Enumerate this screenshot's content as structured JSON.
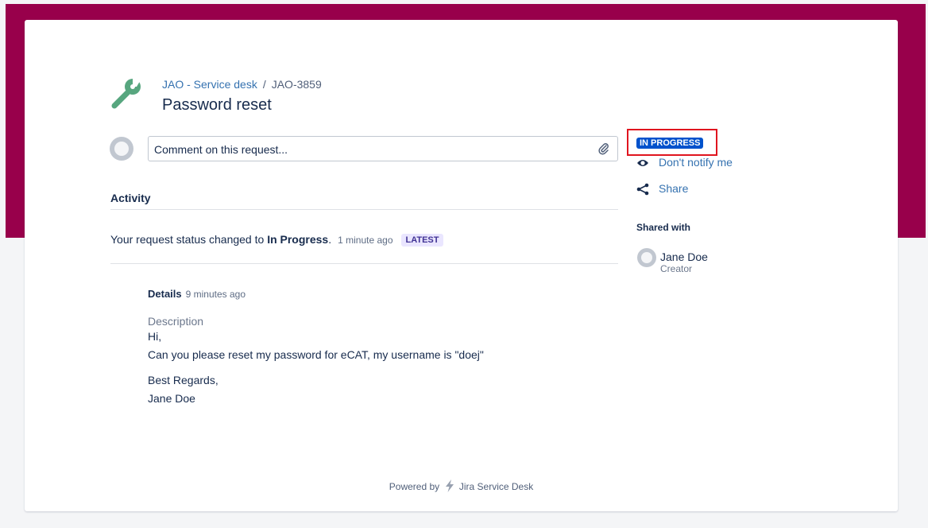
{
  "colors": {
    "brand_band": "#98004b",
    "page_bg": "#f4f5f7",
    "card_bg": "#ffffff",
    "link": "#3572b0",
    "status_lozenge_bg": "#0052cc",
    "latest_lozenge_bg": "#eae6ff",
    "latest_lozenge_fg": "#403294",
    "highlight_box": "#e0151f",
    "wrench_icon": "#57a67f"
  },
  "header": {
    "icon": "wrench-icon",
    "breadcrumb": {
      "project_link": "JAO - Service desk",
      "separator": "/",
      "issue_key": "JAO-3859"
    },
    "title": "Password reset"
  },
  "comment": {
    "avatar": "user-avatar",
    "placeholder": "Comment on this request...",
    "attach_icon": "paperclip-icon"
  },
  "activity": {
    "heading": "Activity",
    "event": {
      "text_before": "Your request status changed to ",
      "status": "In Progress",
      "text_after": ".",
      "time": "1 minute ago",
      "badge": "LATEST"
    }
  },
  "details": {
    "heading": "Details",
    "time": "9 minutes ago",
    "description_label": "Description",
    "lines": [
      "Hi,",
      "Can you please reset my password for eCAT, my username is \"doej\"",
      "Best Regards,",
      "Jane Doe"
    ]
  },
  "sidebar": {
    "status": "IN PROGRESS",
    "notify": {
      "icon": "eye-icon",
      "label": "Don't notify me"
    },
    "share": {
      "icon": "share-icon",
      "label": "Share"
    },
    "shared_with": {
      "heading": "Shared with",
      "people": [
        {
          "name": "Jane Doe",
          "role": "Creator",
          "avatar": "user-avatar"
        }
      ]
    }
  },
  "footer": {
    "prefix": "Powered by",
    "icon": "jira-bolt-icon",
    "product": "Jira Service Desk"
  }
}
